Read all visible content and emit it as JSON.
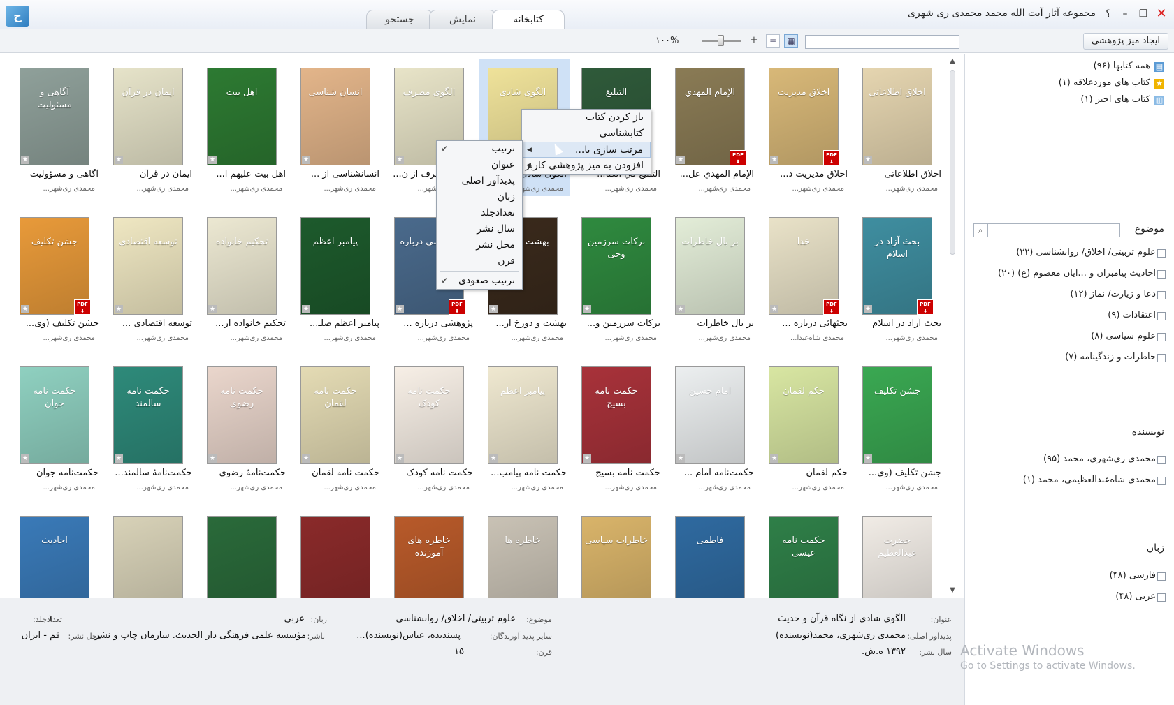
{
  "window": {
    "title": "مجموعه آثار آیت الله محمد محمدی ری شهری",
    "help": "؟",
    "minimize": "–",
    "restore": "❐",
    "close": "✕",
    "logo": "ح"
  },
  "tabs": [
    {
      "label": "کتابخانه"
    },
    {
      "label": "نمایش"
    },
    {
      "label": "جستجو"
    }
  ],
  "toolbar": {
    "new_desk": "ایجاد میز پژوهشی",
    "zoom": "۱۰۰%",
    "zoom_minus": "–",
    "zoom_plus": "+",
    "search_placeholder": ""
  },
  "library": {
    "items": [
      {
        "label": "همه کتابها (۹۶)",
        "icon": "books-icon"
      },
      {
        "label": "کتاب های موردعلاقه (۱)",
        "icon": "star-icon"
      },
      {
        "label": "کتاب های اخیر (۱)",
        "icon": "recent-icon"
      }
    ]
  },
  "filters": {
    "subject_title": "موضوع",
    "subjects": [
      "علوم تربیتی/ اخلاق/ روانشناسی (۲۲)",
      "احادیث پیامبران و ...ایان معصوم (ع) (۲۰)",
      "دعا و زیارت/ نماز (۱۲)",
      "اعتقادات (۹)",
      "علوم سیاسی (۸)",
      "خاطرات و زندگینامه (۷)"
    ],
    "author_title": "نویسنده",
    "authors": [
      "محمدی ری‌شهری، محمد (۹۵)",
      "محمدی شاه‌عبدالعظیمی، محمد (۱)"
    ],
    "language_title": "زبان",
    "languages": [
      "فارسی (۴۸)",
      "عربی (۴۸)"
    ]
  },
  "books": [
    {
      "title": "اخلاق اطلاعاتی",
      "author": "محمدی ری‌شهر...",
      "cover": "اخلاق اطلاعاتی",
      "color": "#e5d5b0",
      "pdf": false
    },
    {
      "title": "اخلاق مدیریت د...",
      "author": "محمدی ری‌شهر...",
      "cover": "اخلاق مدیریت",
      "color": "#d8b878",
      "pdf": true
    },
    {
      "title": "الإمام المهدي عل...",
      "author": "محمدی ری‌شهر...",
      "cover": "الإمام المهدي",
      "color": "#8a7b55",
      "pdf": true
    },
    {
      "title": "التبليغ في الكتا...",
      "author": "محمدی ری‌شهر...",
      "cover": "التبليغ",
      "color": "#2f5a3a",
      "pdf": false
    },
    {
      "title": "الگوی شادی...",
      "author": "محمدی ری‌شهر...",
      "cover": "الگوی شادی",
      "color": "#efe29a",
      "pdf": false
    },
    {
      "title": "الگوی مصرف از ن...",
      "author": "محمدی ری‌شهر...",
      "cover": "الگوی مصرف",
      "color": "#e8e4c8",
      "pdf": false
    },
    {
      "title": "انسانشناسی از ...",
      "author": "محمدی ری‌شهر...",
      "cover": "انسان شناسی",
      "color": "#e3b58a",
      "pdf": false
    },
    {
      "title": "اهل بیت علیهم ا...",
      "author": "محمدی ری‌شهر...",
      "cover": "اهل بیت",
      "color": "#2d7a32",
      "pdf": false
    },
    {
      "title": "ایمان در قرآن",
      "author": "محمدی ری‌شهر...",
      "cover": "ایمان در قرآن",
      "color": "#e6e3c9",
      "pdf": false
    },
    {
      "title": "آگاهی و مسؤولیت",
      "author": "محمدی ری‌شهر...",
      "cover": "آگاهی و مسئولیت",
      "color": "#8fa09a",
      "pdf": false
    },
    {
      "title": "بحث آزاد در اسلام",
      "author": "محمدی ری‌شهر...",
      "cover": "بحث آزاد در اسلام",
      "color": "#3f8ea0",
      "pdf": true
    },
    {
      "title": "بحثهائی درباره ...",
      "author": "محمدی شاه‌عبدا...",
      "cover": "خدا",
      "color": "#e9e2c8",
      "pdf": true
    },
    {
      "title": "بر بال خاطرات",
      "author": "محمدی ری‌شهر...",
      "cover": "بر بال خاطرات",
      "color": "#e3edd8",
      "pdf": false
    },
    {
      "title": "برکات سرزمین و...",
      "author": "محمدی ری‌شهر...",
      "cover": "برکات سرزمین وحی",
      "color": "#2f8a3f",
      "pdf": false
    },
    {
      "title": "بهشت و دوزخ از...",
      "author": "محمدی ری‌شهر...",
      "cover": "بهشت و دوزخ",
      "color": "#3a2a1c",
      "pdf": false
    },
    {
      "title": "پژوهشی درباره ...",
      "author": "محمدی ری‌شهر...",
      "cover": "پژوهشی درباره",
      "color": "#4a6a8c",
      "pdf": true
    },
    {
      "title": "پیامبر اعظم صلـ...",
      "author": "محمدی ری‌شهر...",
      "cover": "پیامبر اعظم",
      "color": "#1d5a2c",
      "pdf": false
    },
    {
      "title": "تحکیم خانواده از...",
      "author": "محمدی ری‌شهر...",
      "cover": "تحکیم خانواده",
      "color": "#ece8d2",
      "pdf": false
    },
    {
      "title": "توسعه اقتصادی ...",
      "author": "محمدی ری‌شهر...",
      "cover": "توسعه اقتصادی",
      "color": "#efe7c2",
      "pdf": false
    },
    {
      "title": "جشن تکلیف (وی...",
      "author": "محمدی ری‌شهر...",
      "cover": "جشن تکلیف",
      "color": "#e89a3a",
      "pdf": true
    },
    {
      "title": "جشن تکلیف (وی...",
      "author": "محمدی ری‌شهر...",
      "cover": "جشن تکلیف",
      "color": "#3aa852",
      "pdf": false
    },
    {
      "title": "حکم لقمان",
      "author": "محمدی ری‌شهر...",
      "cover": "حکم لقمان",
      "color": "#d8e6a2",
      "pdf": false
    },
    {
      "title": "حکمت‌نامه امام ...",
      "author": "محمدی ری‌شهر...",
      "cover": "امام حسین",
      "color": "#eceff0",
      "pdf": false
    },
    {
      "title": "حکمت نامه بسیج",
      "author": "محمدی ری‌شهر...",
      "cover": "حکمت نامه بسیج",
      "color": "#a8323a",
      "pdf": false
    },
    {
      "title": "حکمت نامه پیامب...",
      "author": "محمدی ری‌شهر...",
      "cover": "پیامبر اعظم",
      "color": "#efe8d0",
      "pdf": false
    },
    {
      "title": "حکمت نامه کودک",
      "author": "محمدی ری‌شهر...",
      "cover": "حکمت نامه کودک",
      "color": "#f7efe6",
      "pdf": false
    },
    {
      "title": "حکمت نامه لقمان",
      "author": "محمدی ری‌شهر...",
      "cover": "حکمت نامه لقمان",
      "color": "#e4dbb4",
      "pdf": false
    },
    {
      "title": "حکمت‌نامهٔ رضوی",
      "author": "محمدی ری‌شهر...",
      "cover": "حکمت نامه رضوی",
      "color": "#ead6cc",
      "pdf": false
    },
    {
      "title": "حکمت‌نامهٔ سالمند...",
      "author": "محمدی ری‌شهر...",
      "cover": "حکمت نامه سالمند",
      "color": "#2e8a7a",
      "pdf": false
    },
    {
      "title": "حکمت‌نامه جوان",
      "author": "محمدی ری‌شهر...",
      "cover": "حکمت نامه جوان",
      "color": "#8fd0c0",
      "pdf": false
    },
    {
      "title": "",
      "author": "",
      "cover": "حضرت عبدالعظیم",
      "color": "#f1ece6",
      "pdf": false
    },
    {
      "title": "",
      "author": "",
      "cover": "حکمت نامه عیسی",
      "color": "#2f7f48",
      "pdf": false
    },
    {
      "title": "",
      "author": "",
      "cover": "فاطمی",
      "color": "#2f6aa0",
      "pdf": false
    },
    {
      "title": "",
      "author": "",
      "cover": "خاطرات سیاسی",
      "color": "#d9b46a",
      "pdf": true
    },
    {
      "title": "",
      "author": "",
      "cover": "خاطره ها",
      "color": "#c9c2b5",
      "pdf": true
    },
    {
      "title": "",
      "author": "",
      "cover": "خاطره های آموزنده",
      "color": "#b85a2a",
      "pdf": false
    },
    {
      "title": "",
      "author": "",
      "cover": "",
      "color": "#8a2a2a",
      "pdf": false
    },
    {
      "title": "",
      "author": "",
      "cover": "",
      "color": "#2a6a3a",
      "pdf": false
    },
    {
      "title": "",
      "author": "",
      "cover": "",
      "color": "#d8d2b8",
      "pdf": false
    },
    {
      "title": "",
      "author": "",
      "cover": "احادیث",
      "color": "#3a7ab8",
      "pdf": false
    }
  ],
  "context_menu": {
    "items": [
      "باز کردن کتاب",
      "کتابشناسی",
      "مرتب سازی با...",
      "افزودن به میز پژوهشی کاربر"
    ]
  },
  "sort_menu": {
    "items": [
      "ترتیب",
      "عنوان",
      "پدیدآور اصلی",
      "زبان",
      "تعدادجلد",
      "سال نشر",
      "محل نشر",
      "قرن"
    ],
    "ascending": "ترتیب صعودی"
  },
  "details": {
    "title_label": "عنوان:",
    "title_value": "الگوی شادی از نگاه قرآن و حدیث",
    "subject_label": "موضوع:",
    "subject_value": "علوم تربیتی/ اخلاق/ روانشناسی",
    "lang_label": "زبان:",
    "lang_value": "عربی",
    "vol_label": "تعدادجلد:",
    "vol_value": "۱",
    "author_label": "پدیدآور اصلی:",
    "author_value": "محمدی ری‌شهری، محمد(نویسنده)",
    "other_label": "سایر پدید آورندگان:",
    "other_value": "پسندیده، عباس(نویسنده)...",
    "pub_label": "ناشر:",
    "pub_value": "مؤسسه علمی فرهنگی دار الحديث. سازمان چاپ و نشر",
    "place_label": "محل نشر:",
    "place_value": "قم - ایران",
    "year_label": "سال نشر:",
    "year_value": "۱۳۹۲ ه.ش.",
    "century_label": "قرن:",
    "century_value": "۱۵"
  },
  "watermark": {
    "line1": "Activate Windows",
    "line2": "Go to Settings to activate Windows."
  }
}
